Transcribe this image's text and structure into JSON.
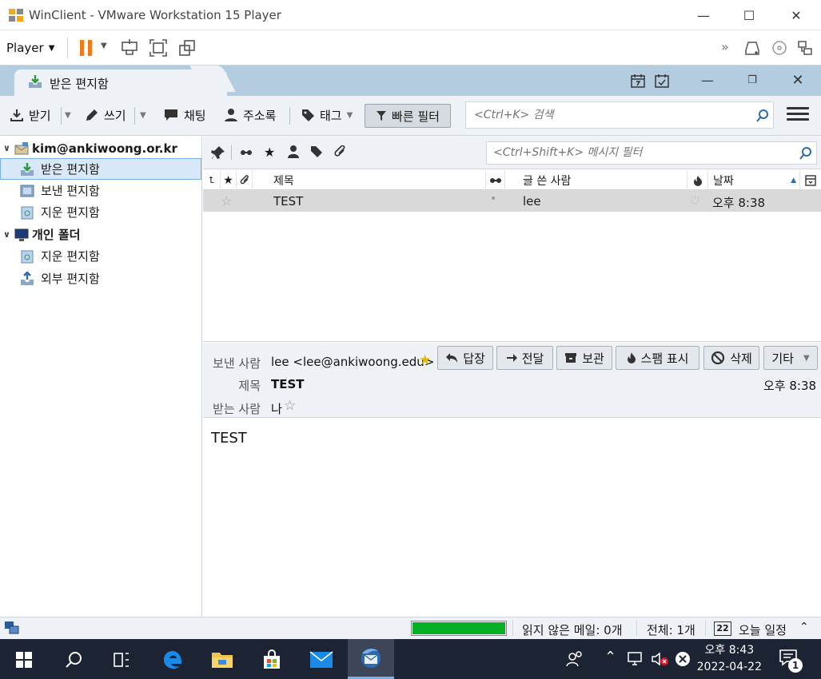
{
  "vmware": {
    "title": "WinClient - VMware Workstation 15 Player",
    "player_menu": "Player"
  },
  "tab": {
    "label": "받은 편지함"
  },
  "toolbar": {
    "get": "받기",
    "write": "쓰기",
    "chat": "채팅",
    "addressbook": "주소록",
    "tag": "태그",
    "quick_filter": "빠른 필터",
    "search_placeholder": "<Ctrl+K> 검색"
  },
  "folders": {
    "account": "kim@ankiwoong.or.kr",
    "inbox": "받은 편지함",
    "sent": "보낸 편지함",
    "trash": "지운 편지함",
    "local": "개인 폴더",
    "local_trash": "지운 편지함",
    "outbox": "외부 편지함"
  },
  "filter": {
    "placeholder": "<Ctrl+Shift+K> 메시지 필터"
  },
  "columns": {
    "subject": "제목",
    "author": "글 쓴 사람",
    "date": "날짜"
  },
  "messages": [
    {
      "subject": "TEST",
      "author": "lee",
      "date": "오후 8:38"
    }
  ],
  "header": {
    "from_label": "보낸 사람",
    "from_value": "lee <lee@ankiwoong.edu>",
    "subject_label": "제목",
    "subject_value": "TEST",
    "to_label": "받는 사람",
    "to_value": "나",
    "time": "오후 8:38",
    "reply": "답장",
    "forward": "전달",
    "archive": "보관",
    "junk": "스팸 표시",
    "delete": "삭제",
    "more": "기타"
  },
  "body": {
    "text": "TEST"
  },
  "status": {
    "unread": "읽지 않은 메일: 0개",
    "total": "전체: 1개",
    "today_badge": "22",
    "today": "오늘 일정",
    "progress": 1.0
  },
  "taskbar": {
    "time": "오후 8:43",
    "date": "2022-04-22",
    "notif_count": "1"
  }
}
